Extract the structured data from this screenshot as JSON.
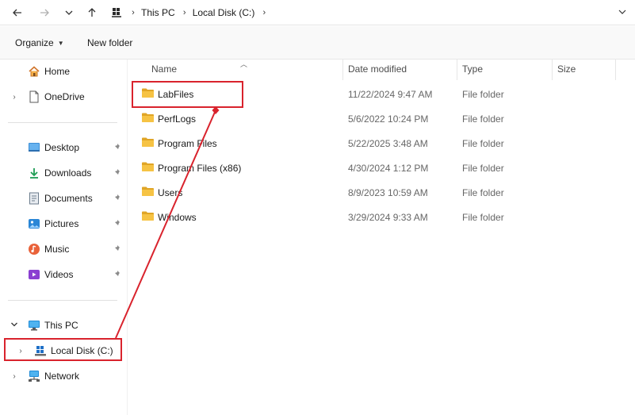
{
  "address_bar": {
    "back_icon": "arrow-left-icon",
    "forward_icon": "arrow-right-icon",
    "recent_icon": "chevron-down-icon",
    "up_icon": "arrow-up-icon",
    "breadcrumbs": [
      {
        "label": "This PC"
      },
      {
        "label": "Local Disk (C:)"
      }
    ],
    "separator": "›"
  },
  "command_bar": {
    "organize_label": "Organize",
    "new_folder_label": "New folder"
  },
  "sidebar": {
    "items": [
      {
        "label": "Home",
        "icon": "home-icon",
        "chevron": "",
        "pinned": false
      },
      {
        "label": "OneDrive",
        "icon": "document-icon",
        "chevron": "›",
        "pinned": false
      },
      {
        "label": "Desktop",
        "icon": "desktop-icon",
        "chevron": "",
        "pinned": true
      },
      {
        "label": "Downloads",
        "icon": "download-icon",
        "chevron": "",
        "pinned": true
      },
      {
        "label": "Documents",
        "icon": "documents-icon",
        "chevron": "",
        "pinned": true
      },
      {
        "label": "Pictures",
        "icon": "pictures-icon",
        "chevron": "",
        "pinned": true
      },
      {
        "label": "Music",
        "icon": "music-icon",
        "chevron": "",
        "pinned": true
      },
      {
        "label": "Videos",
        "icon": "videos-icon",
        "chevron": "",
        "pinned": true
      },
      {
        "label": "This PC",
        "icon": "monitor-icon",
        "chevron": "⌄",
        "pinned": false
      },
      {
        "label": "Local Disk (C:)",
        "icon": "drive-icon",
        "chevron": "›",
        "pinned": false
      },
      {
        "label": "Network",
        "icon": "network-icon",
        "chevron": "›",
        "pinned": false
      }
    ]
  },
  "file_list": {
    "columns": {
      "name": "Name",
      "date_modified": "Date modified",
      "type": "Type",
      "size": "Size"
    },
    "rows": [
      {
        "name": "LabFiles",
        "date_modified": "11/22/2024 9:47 AM",
        "type": "File folder"
      },
      {
        "name": "PerfLogs",
        "date_modified": "5/6/2022 10:24 PM",
        "type": "File folder"
      },
      {
        "name": "Program Files",
        "date_modified": "5/22/2025 3:48 AM",
        "type": "File folder"
      },
      {
        "name": "Program Files (x86)",
        "date_modified": "4/30/2024 1:12 PM",
        "type": "File folder"
      },
      {
        "name": "Users",
        "date_modified": "8/9/2023 10:59 AM",
        "type": "File folder"
      },
      {
        "name": "Windows",
        "date_modified": "3/29/2024 9:33 AM",
        "type": "File folder"
      }
    ]
  },
  "colors": {
    "annotation_red": "#d9232d",
    "folder_yellow": "#f6c344",
    "folder_dark": "#e0a526",
    "accent_blue": "#1e6fc7"
  }
}
